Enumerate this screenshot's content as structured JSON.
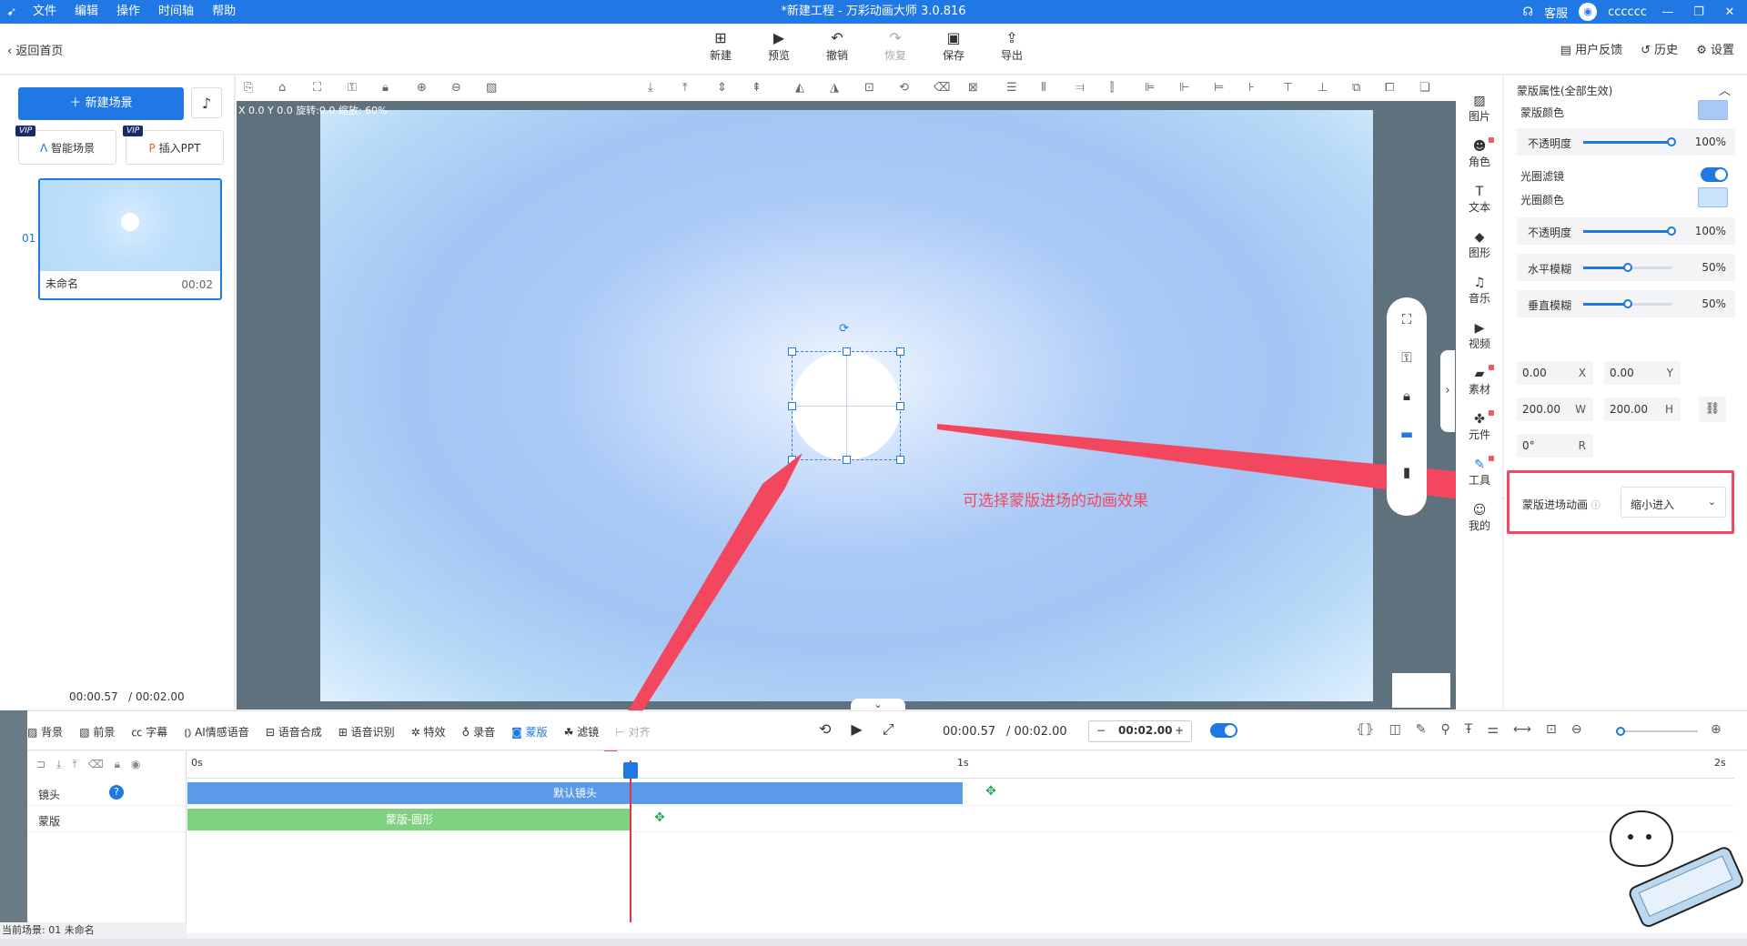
{
  "titlebar": {
    "title": "*新建工程 - 万彩动画大师 3.0.816",
    "menu": [
      "文件",
      "编辑",
      "操作",
      "时间轴",
      "帮助"
    ],
    "service": "客服",
    "username": "cccccc"
  },
  "toolbar": {
    "back": "返回首页",
    "tools": [
      "新建",
      "预览",
      "撤销",
      "恢复",
      "保存",
      "导出"
    ],
    "right": [
      "用户反馈",
      "历史",
      "设置"
    ]
  },
  "left": {
    "new_scene": "新建场景",
    "smart_scene": "智能场景",
    "insert_ppt": "插入PPT",
    "vip": "VIP",
    "scene_index": "01",
    "scene_name": "未命名",
    "scene_duration": "00:02",
    "time_current": "00:00.57",
    "time_total": "/ 00:02.00"
  },
  "canvas": {
    "coords": "X 0.0  Y 0.0  旋转:0.0  缩放: 60%",
    "annotation": "可选择蒙版进场的动画效果"
  },
  "sideicons": [
    "图片",
    "角色",
    "文本",
    "图形",
    "音乐",
    "视频",
    "素材",
    "元件",
    "工具",
    "我的"
  ],
  "props": {
    "header": "蒙版属性(全部生效)",
    "mask_color_label": "蒙版颜色",
    "opacity_label": "不透明度",
    "opacity_value": "100%",
    "halo_filter_label": "光圈滤镜",
    "halo_color_label": "光圈颜色",
    "halo_opacity_value": "100%",
    "hblur_label": "水平模糊",
    "hblur_value": "50%",
    "vblur_label": "垂直模糊",
    "vblur_value": "50%",
    "x": "0.00",
    "y": "0.00",
    "w": "200.00",
    "h": "200.00",
    "r": "0°",
    "x_unit": "X",
    "y_unit": "Y",
    "w_unit": "W",
    "h_unit": "H",
    "r_unit": "R",
    "anim_label": "蒙版进场动画",
    "anim_value": "缩小进入",
    "mask_color_hex": "#a9c8f5",
    "halo_color_hex": "#c7e4fb"
  },
  "timeline": {
    "tabs": [
      "背景",
      "前景",
      "字幕",
      "AI情感语音",
      "语音合成",
      "语音识别",
      "特效",
      "录音",
      "蒙版",
      "滤镜",
      "对齐"
    ],
    "time_current": "00:00.57",
    "time_total": "/ 00:02.00",
    "stepper_value": "00:02.00",
    "ruler": [
      "0s",
      "1s",
      "2s"
    ],
    "tracks": [
      {
        "name": "镜头",
        "clip": "默认镜头"
      },
      {
        "name": "蒙版",
        "clip": "蒙版-圆形"
      }
    ],
    "status": "当前场景: 01   未命名"
  }
}
